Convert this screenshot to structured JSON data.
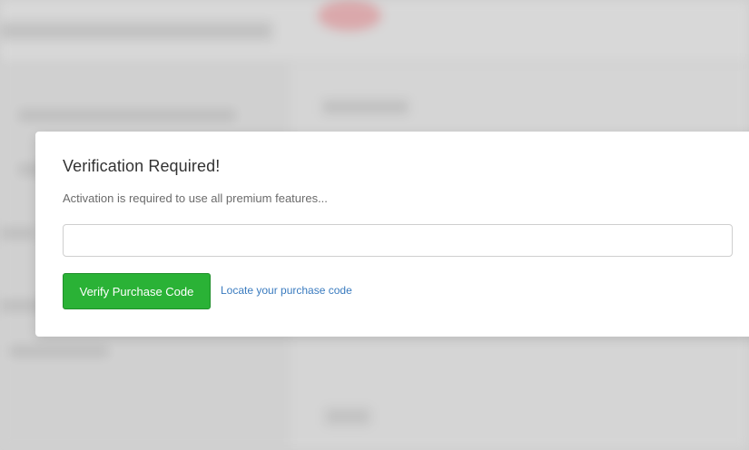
{
  "dialog": {
    "title": "Verification Required!",
    "description": "Activation is required to use all premium features...",
    "purchase_code": {
      "value": "",
      "placeholder": ""
    },
    "verify_button_label": "Verify Purchase Code",
    "locate_link_label": "Locate your purchase code"
  },
  "colors": {
    "verify_button": "#2ab236",
    "link": "#3a7bbf",
    "backdrop": "#dcdcdc"
  }
}
